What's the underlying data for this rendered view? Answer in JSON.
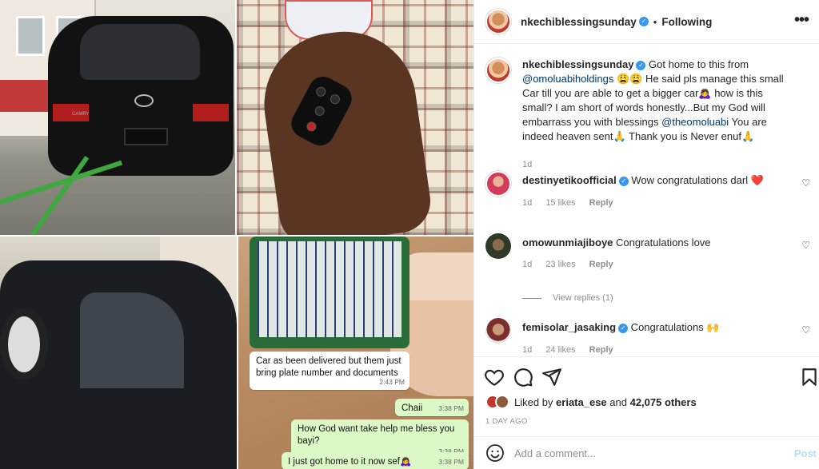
{
  "post": {
    "username": "nkechiblessingsunday",
    "follow_status": "Following",
    "more_label": "•••",
    "caption": {
      "username": "nkechiblessingsunday",
      "text_1": " Got home to this from ",
      "mention_1": "@omoluabiholdings",
      "text_2": " 😩😩 He said pls manage this small Car till you are able to get a bigger car🙇‍♀️ how is this small? I am short of words honestly...But my God will embarrass you with blessings ",
      "mention_2": "@theomoluabi",
      "text_3": " You are indeed heaven sent🙏 Thank you is Never enuf🙏",
      "age": "1d"
    },
    "comments": [
      {
        "username": "destinyetikoofficial",
        "verified": true,
        "text": " Wow congratulations darl ❤️",
        "age": "1d",
        "likes": "15 likes",
        "reply": "Reply"
      },
      {
        "username": "omowunmiajiboye",
        "verified": false,
        "text": " Congratulations love",
        "age": "1d",
        "likes": "23 likes",
        "reply": "Reply"
      },
      {
        "username": "femisolar_jasaking",
        "verified": true,
        "text": " Congratulations 🙌",
        "age": "1d",
        "likes": "24 likes",
        "reply": "Reply"
      }
    ],
    "view_replies": "View replies (1)",
    "liked_by": {
      "prefix": "Liked by ",
      "user": "eriata_ese",
      "middle": " and ",
      "count": "42,075 others"
    },
    "time_ago": "1 DAY AGO",
    "add_comment_placeholder": "Add a comment...",
    "post_button": "Post"
  },
  "chat": {
    "incoming": {
      "text": "Car as been delivered but them just bring plate number and documents",
      "time": "2:43 PM"
    },
    "outgoing": [
      {
        "text": "Chaii",
        "time": "3:38 PM"
      },
      {
        "text": "How God want take help me bless you bayi?",
        "time": "3:38 PM"
      },
      {
        "text": "I just got home to it now sef🙇‍♀️",
        "time": "3:38 PM"
      }
    ]
  },
  "photos": {
    "car_rear_model": "CAMRY",
    "key_fob": "car key fob"
  },
  "colors": {
    "verified": "#3897f0",
    "link": "#00376b",
    "muted": "#8e8e8e",
    "post_button": "#b2dffc",
    "chat_outgoing": "#dcf8c6"
  }
}
